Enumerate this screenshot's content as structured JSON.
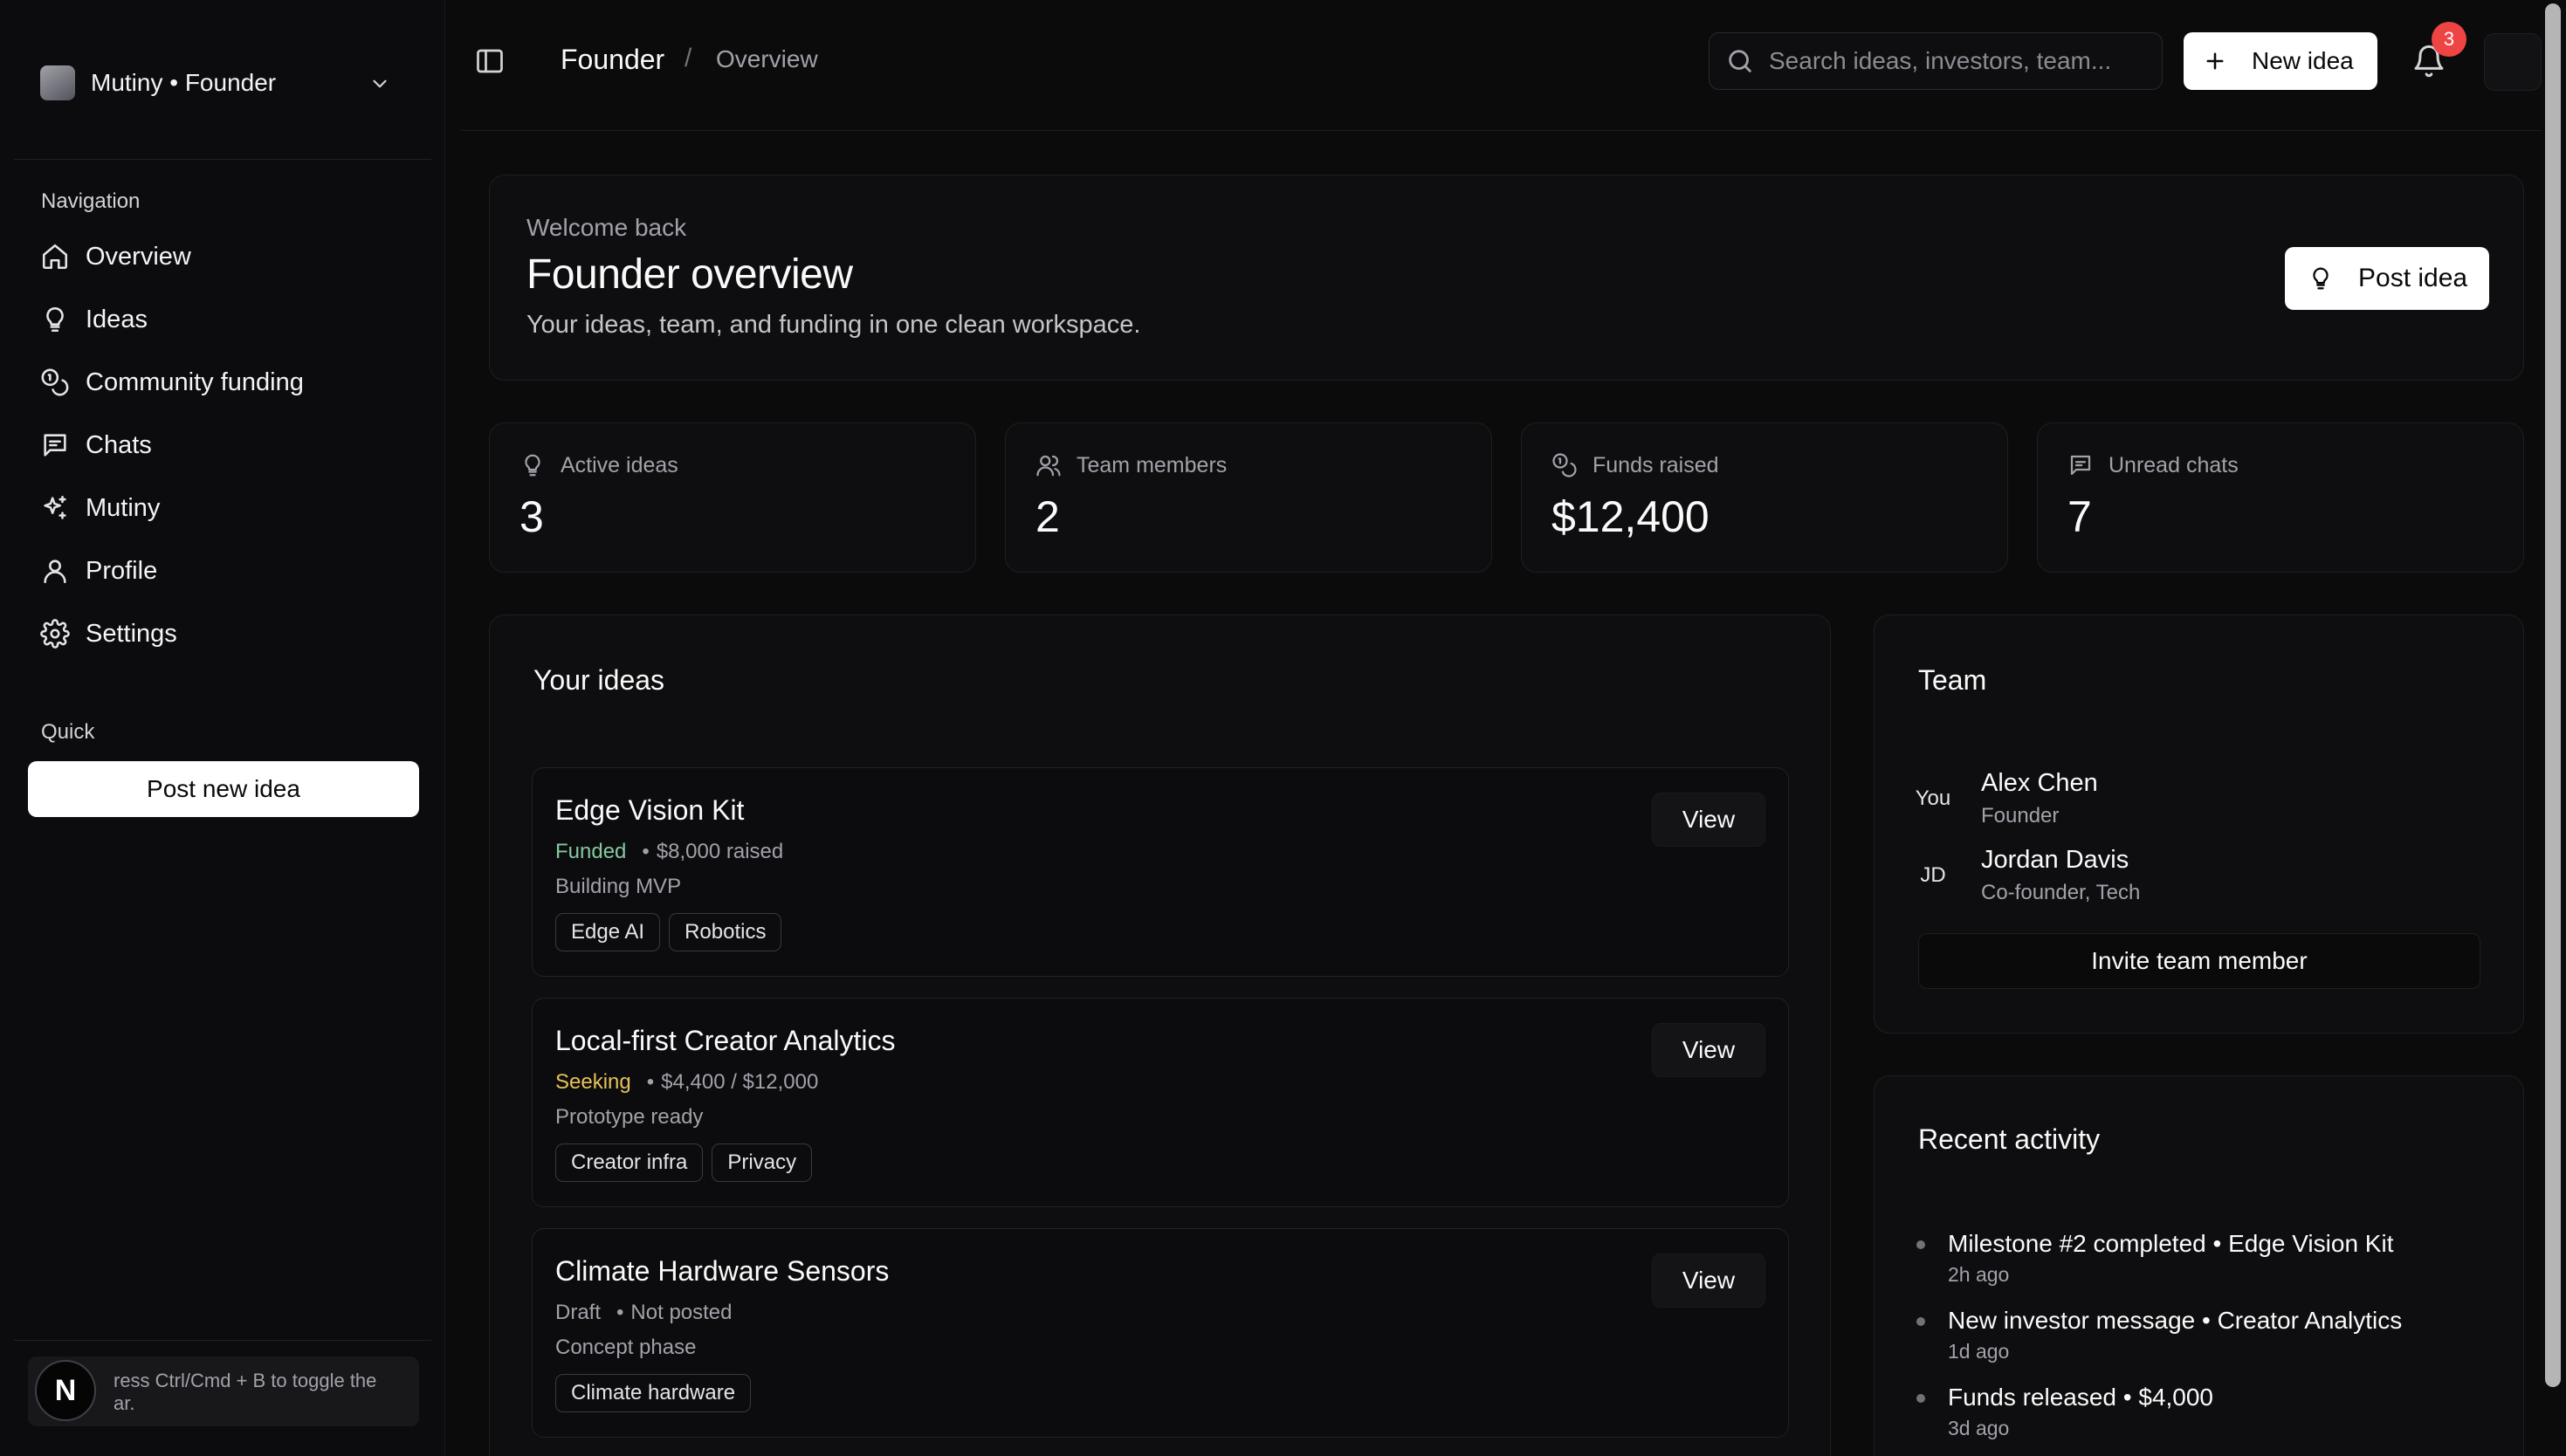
{
  "workspace": {
    "name": "Mutiny • Founder"
  },
  "sidebar": {
    "navigation_label": "Navigation",
    "items": [
      {
        "label": "Overview",
        "icon": "home-icon"
      },
      {
        "label": "Ideas",
        "icon": "lightbulb-icon"
      },
      {
        "label": "Community funding",
        "icon": "coins-icon"
      },
      {
        "label": "Chats",
        "icon": "message-icon"
      },
      {
        "label": "Mutiny",
        "icon": "sparkles-icon"
      },
      {
        "label": "Profile",
        "icon": "user-icon"
      },
      {
        "label": "Settings",
        "icon": "gear-icon"
      }
    ],
    "quick_label": "Quick",
    "quick_button": "Post new idea",
    "hint": "ress Ctrl/Cmd + B to toggle the\nar.",
    "badge": "N"
  },
  "header": {
    "breadcrumb_root": "Founder",
    "breadcrumb_sep": "/",
    "breadcrumb_leaf": "Overview",
    "search_placeholder": "Search ideas, investors, team...",
    "new_idea": "New idea",
    "notification_count": "3"
  },
  "welcome": {
    "kicker": "Welcome back",
    "title": "Founder overview",
    "subtitle": "Your ideas, team, and funding in one clean workspace.",
    "post_idea": "Post idea"
  },
  "stats": [
    {
      "label": "Active ideas",
      "value": "3",
      "icon": "lightbulb-icon"
    },
    {
      "label": "Team members",
      "value": "2",
      "icon": "users-icon"
    },
    {
      "label": "Funds raised",
      "value": "$12,400",
      "icon": "coins-icon"
    },
    {
      "label": "Unread chats",
      "value": "7",
      "icon": "message-icon"
    }
  ],
  "ideas": {
    "title": "Your ideas",
    "view_label": "View",
    "items": [
      {
        "title": "Edge Vision Kit",
        "status": "Funded",
        "status_color": "#86c9a0",
        "detail": "$8,000 raised",
        "stage": "Building MVP",
        "tags": [
          "Edge AI",
          "Robotics"
        ]
      },
      {
        "title": "Local-first Creator Analytics",
        "status": "Seeking",
        "status_color": "#e6c15a",
        "detail": "$4,400 / $12,000",
        "stage": "Prototype ready",
        "tags": [
          "Creator infra",
          "Privacy"
        ]
      },
      {
        "title": "Climate Hardware Sensors",
        "status": "Draft",
        "status_color": "#a1a1aa",
        "detail": "Not posted",
        "stage": "Concept phase",
        "tags": [
          "Climate hardware"
        ]
      }
    ]
  },
  "team": {
    "title": "Team",
    "members": [
      {
        "initials": "You",
        "name": "Alex Chen",
        "role": "Founder"
      },
      {
        "initials": "JD",
        "name": "Jordan Davis",
        "role": "Co-founder, Tech"
      }
    ],
    "invite": "Invite team member"
  },
  "activity": {
    "title": "Recent activity",
    "items": [
      {
        "text": "Milestone #2 completed • Edge Vision Kit",
        "time": "2h ago"
      },
      {
        "text": "New investor message • Creator Analytics",
        "time": "1d ago"
      },
      {
        "text": "Funds released • $4,000",
        "time": "3d ago"
      }
    ]
  }
}
